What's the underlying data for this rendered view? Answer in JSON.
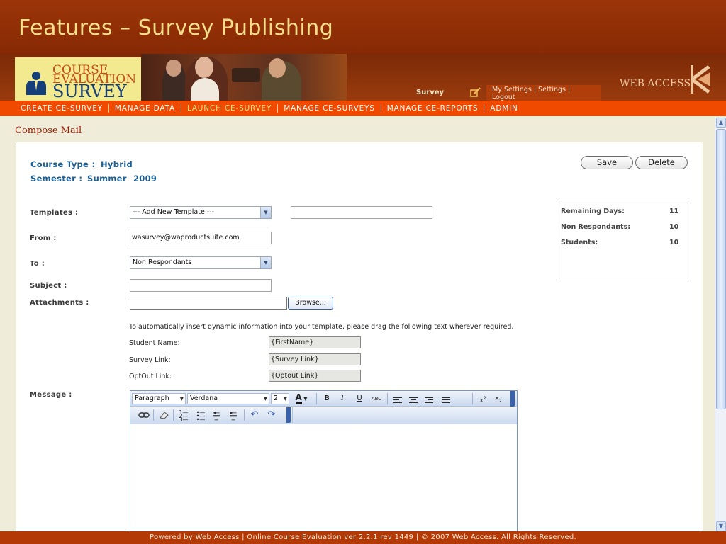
{
  "header": {
    "title": "Features – Survey Publishing"
  },
  "logo": {
    "line1": "COURSE",
    "line2": "EVALUATION",
    "line3": "SURVEY"
  },
  "user_area": {
    "survey_label": "Survey",
    "links_line1": "My Settings | Settings |",
    "links_line2": "Logout"
  },
  "brand": {
    "name": "WEB ACCESS"
  },
  "nav": {
    "items": [
      {
        "label": "CREATE CE-SURVEY"
      },
      {
        "label": "MANAGE DATA"
      },
      {
        "label": "LAUNCH CE-SURVEY"
      },
      {
        "label": "MANAGE CE-SURVEYS"
      },
      {
        "label": "MANAGE CE-REPORTS"
      },
      {
        "label": "ADMIN"
      }
    ],
    "active_index": 2
  },
  "page": {
    "section_title": "Compose Mail"
  },
  "course": {
    "type_label": "Course Type :",
    "type_value": "Hybrid",
    "semester_label": "Semester :",
    "semester_value": "Summer",
    "year_value": "2009"
  },
  "actions": {
    "save": "Save",
    "delete": "Delete"
  },
  "form": {
    "templates_label": "Templates :",
    "templates_selected": "--- Add New Template ---",
    "template_name_value": "",
    "from_label": "From :",
    "from_value": "wasurvey@waproductsuite.com",
    "to_label": "To :",
    "to_selected": "Non Respondants",
    "subject_label": "Subject :",
    "subject_value": "",
    "attachments_label": "Attachments :",
    "attachments_value": "",
    "browse_label": "Browse...",
    "message_label": "Message :"
  },
  "stats": {
    "remaining_days_label": "Remaining Days:",
    "remaining_days_value": "11",
    "non_respondants_label": "Non Respondants:",
    "non_respondants_value": "10",
    "students_label": "Students:",
    "students_value": "10"
  },
  "dynamic": {
    "hint": "To automatically insert dynamic information into your template, please drag the following text wherever required.",
    "student_name_label": "Student Name:",
    "student_name_token": "{FirstName}",
    "survey_link_label": "Survey Link:",
    "survey_link_token": "{Survey Link}",
    "optout_link_label": "OptOut Link:",
    "optout_link_token": "{Optout Link}"
  },
  "editor": {
    "format_select": "Paragraph",
    "font_select": "Verdana",
    "size_select": "2",
    "bold": "B",
    "italic": "I",
    "underline": "U",
    "strikethrough": "ABC",
    "body": ""
  },
  "footer": {
    "text": "Powered by Web Access | Online Course Evaluation ver 2.2.1 rev 1449 | © 2007 Web Access. All Rights Reserved."
  },
  "colors": {
    "nav_bg": "#ef4a00",
    "header_bg": "#9c3408",
    "label_blue": "#1c5f95",
    "section_red": "#9a1a00"
  }
}
